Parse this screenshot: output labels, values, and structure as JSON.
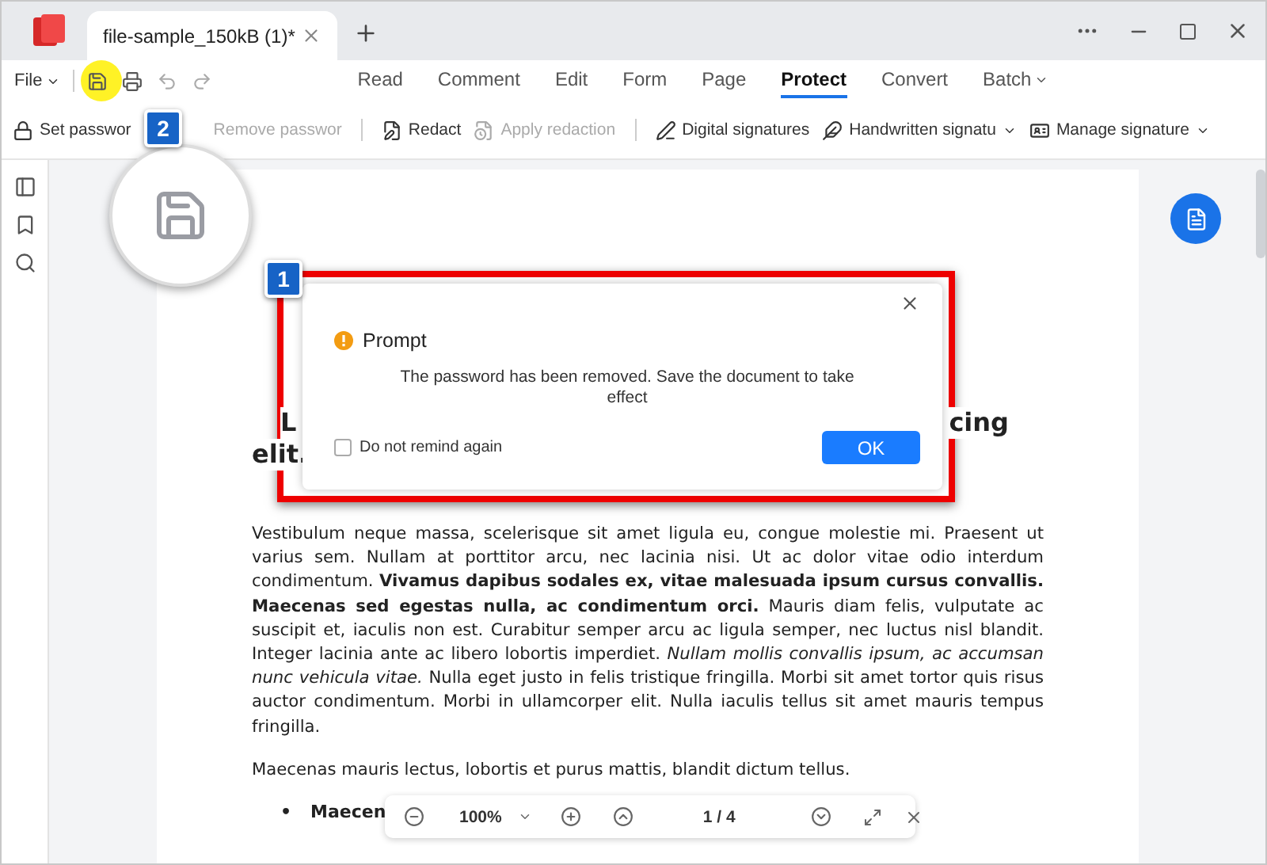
{
  "app_tab": {
    "title": "file-sample_150kB (1)*"
  },
  "menu": {
    "file": "File",
    "items": [
      {
        "label": "Read",
        "selected": false,
        "dropdown": false
      },
      {
        "label": "Comment",
        "selected": false,
        "dropdown": false
      },
      {
        "label": "Edit",
        "selected": false,
        "dropdown": false
      },
      {
        "label": "Form",
        "selected": false,
        "dropdown": false
      },
      {
        "label": "Page",
        "selected": false,
        "dropdown": false
      },
      {
        "label": "Protect",
        "selected": true,
        "dropdown": false
      },
      {
        "label": "Convert",
        "selected": false,
        "dropdown": false
      },
      {
        "label": "Batch",
        "selected": false,
        "dropdown": true
      }
    ]
  },
  "toolbar": [
    {
      "label": "Set passwor",
      "disabled": false,
      "dropdown": false
    },
    {
      "label": "Remove passwor",
      "disabled": true,
      "dropdown": false
    },
    {
      "label": "Redact",
      "disabled": false,
      "dropdown": false
    },
    {
      "label": "Apply redaction",
      "disabled": true,
      "dropdown": false
    },
    {
      "label": "Digital signatures",
      "disabled": false,
      "dropdown": false
    },
    {
      "label": "Handwritten signatu",
      "disabled": false,
      "dropdown": true
    },
    {
      "label": "Manage signature",
      "disabled": false,
      "dropdown": true
    }
  ],
  "document": {
    "heading_start": "L",
    "heading_end": "cing",
    "heading_line_2": "elit.",
    "paragraphs": [
      "Vestibulum neque massa, scelerisque sit amet ligula eu, congue molestie mi. Praesent ut varius sem. Nullam at porttitor arcu, nec lacinia nisi. Ut ac dolor vitae odio interdum condimentum. **Vivamus dapibus sodales ex, vitae malesuada ipsum cursus convallis. Maecenas sed egestas nulla, ac condimentum orci.** Mauris diam felis, vulputate ac suscipit et, iaculis non est. Curabitur semper arcu ac ligula semper, nec luctus nisl blandit. Integer lacinia ante ac libero lobortis imperdiet. *Nullam mollis convallis ipsum, ac accumsan nunc vehicula vitae.* Nulla eget justo in felis tristique fringilla. Morbi sit amet tortor quis risus auctor condimentum. Morbi in ullamcorper elit. Nulla iaculis tellus sit amet mauris tempus fringilla.",
      "Maecenas mauris lectus, lobortis et purus mattis, blandit dictum tellus."
    ],
    "bullets": [
      {
        "marker": "•",
        "text": "Maecen"
      }
    ]
  },
  "dialog": {
    "title": "Prompt",
    "message": "The password has been removed. Save the document to take effect",
    "checkbox": {
      "label": "Do not remind again",
      "checked": false
    },
    "button": "OK"
  },
  "zoom_bar": {
    "zoom": "100%",
    "page": "1 / 4"
  },
  "callouts": [
    "1",
    "2"
  ]
}
